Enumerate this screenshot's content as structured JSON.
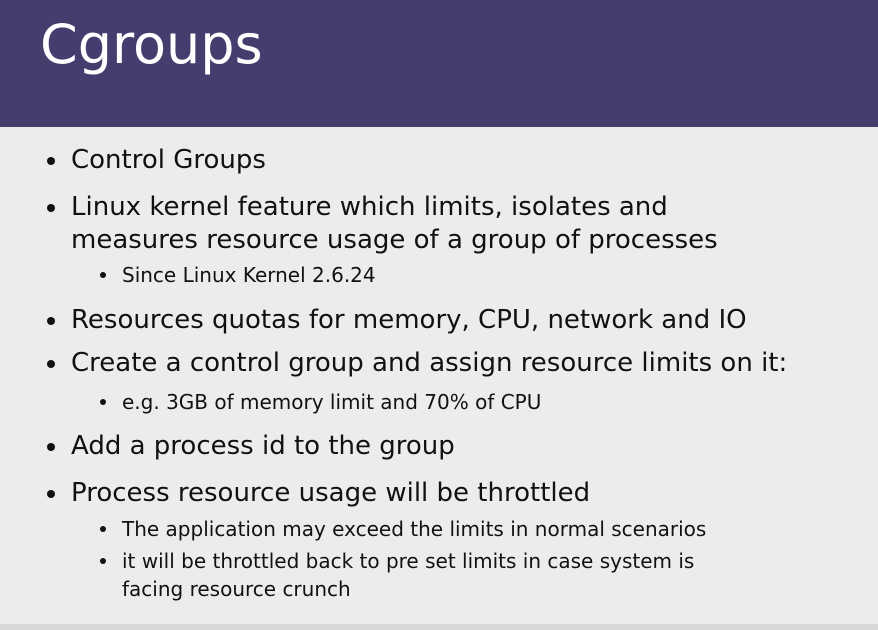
{
  "slide": {
    "title": "Cgroups",
    "colors": {
      "title_bar": "#453d6e",
      "title_text": "#ffffff",
      "body_background": "#ececec",
      "body_text": "#111111"
    },
    "bullets": [
      {
        "level": 1,
        "lines": [
          "Control Groups"
        ]
      },
      {
        "level": 1,
        "lines": [
          "Linux kernel feature which limits, isolates and",
          "measures resource usage of a group of processes"
        ]
      },
      {
        "level": 2,
        "lines": [
          "Since Linux Kernel 2.6.24"
        ]
      },
      {
        "level": 1,
        "lines": [
          "Resources quotas for memory, CPU, network and IO"
        ]
      },
      {
        "level": 1,
        "lines": [
          "Create a control group and assign resource limits on it:"
        ]
      },
      {
        "level": 2,
        "lines": [
          "e.g. 3GB of memory limit and 70% of CPU"
        ]
      },
      {
        "level": 1,
        "lines": [
          "Add a process id to the group"
        ]
      },
      {
        "level": 1,
        "lines": [
          "Process resource usage will be throttled"
        ]
      },
      {
        "level": 2,
        "lines": [
          "The application may exceed the limits in normal scenarios"
        ]
      },
      {
        "level": 2,
        "lines": [
          "it will be throttled back to pre set limits in case system is",
          "facing resource crunch"
        ]
      }
    ]
  }
}
